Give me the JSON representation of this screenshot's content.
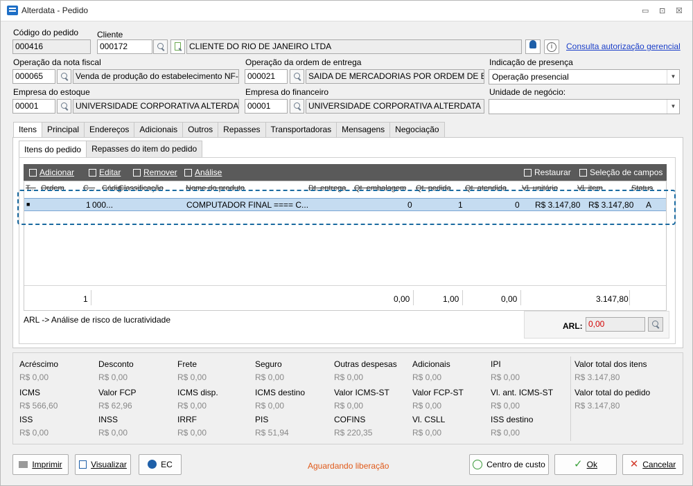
{
  "window": {
    "title": "Alterdata - Pedido",
    "min": "▭",
    "max": "⊡",
    "close": "☒"
  },
  "header": {
    "codigo_label": "Código do pedido",
    "codigo_value": "000416",
    "cliente_label": "Cliente",
    "cliente_code": "000172",
    "cliente_name": "CLIENTE DO RIO DE JANEIRO LTDA",
    "consulta_link": "Consulta autorização gerencial",
    "op_nf_label": "Operação da nota fiscal",
    "op_nf_code": "000065",
    "op_nf_name": "Venda de produção do estabelecimento NF-e",
    "op_oe_label": "Operação da ordem de entrega",
    "op_oe_code": "000021",
    "op_oe_name": "SAIDA DE MERCADORIAS POR ORDEM DE ENTRE",
    "presenca_label": "Indicação de presença",
    "presenca_value": "Operação presencial",
    "emp_est_label": "Empresa do estoque",
    "emp_est_code": "00001",
    "emp_est_name": "UNIVERSIDADE CORPORATIVA ALTERDATA",
    "emp_fin_label": "Empresa do financeiro",
    "emp_fin_code": "00001",
    "emp_fin_name": "UNIVERSIDADE CORPORATIVA ALTERDATA",
    "unidade_label": "Unidade de negócio:",
    "unidade_value": ""
  },
  "tabs": [
    "Itens",
    "Principal",
    "Endereços",
    "Adicionais",
    "Outros",
    "Repasses",
    "Transportadoras",
    "Mensagens",
    "Negociação"
  ],
  "subtabs": [
    "Itens do pedido",
    "Repasses do item do pedido"
  ],
  "toolbar": {
    "adicionar": "Adicionar",
    "editar": "Editar",
    "remover": "Remover",
    "analise": "Análise",
    "restaurar": "Restaurar",
    "selecao": "Seleção de campos"
  },
  "grid": {
    "columns": [
      "T...",
      "Ordem",
      "C...",
      "Códig",
      "Classificação",
      "Nome do produto",
      "Dt. entrega",
      "Qt. embalagem",
      "Qt. pedida",
      "Qt. atendida",
      "Vl. unitário",
      "Vl. item",
      "Status"
    ],
    "row": {
      "t": "■",
      "ordem": "1",
      "codigo": "000...",
      "nome": "COMPUTADOR FINAL ==== C...",
      "qt_emb": "0",
      "qt_ped": "1",
      "qt_at": "0",
      "vl_unit": "R$ 3.147,80",
      "vl_item": "R$ 3.147,80",
      "status": "A"
    },
    "footer": {
      "count": "1",
      "qt_emb": "0,00",
      "qt_ped": "1,00",
      "qt_at": "0,00",
      "vl_item": "3.147,80"
    }
  },
  "arl": {
    "caption": "ARL -> Análise de risco de lucratividade",
    "label": "ARL:",
    "value": "0,00"
  },
  "totals": [
    {
      "label": "Acréscimo",
      "value": "R$ 0,00"
    },
    {
      "label": "Desconto",
      "value": "R$ 0,00"
    },
    {
      "label": "Frete",
      "value": "R$ 0,00"
    },
    {
      "label": "Seguro",
      "value": "R$ 0,00"
    },
    {
      "label": "Outras despesas",
      "value": "R$ 0,00"
    },
    {
      "label": "Adicionais",
      "value": "R$ 0,00"
    },
    {
      "label": "IPI",
      "value": "R$ 0,00"
    },
    {
      "label": "ICMS",
      "value": "R$ 566,60"
    },
    {
      "label": "Valor FCP",
      "value": "R$ 62,96"
    },
    {
      "label": "ICMS disp.",
      "value": "R$ 0,00"
    },
    {
      "label": "ICMS destino",
      "value": "R$ 0,00"
    },
    {
      "label": "Valor ICMS-ST",
      "value": "R$ 0,00"
    },
    {
      "label": "Valor FCP-ST",
      "value": "R$ 0,00"
    },
    {
      "label": "Vl. ant. ICMS-ST",
      "value": "R$ 0,00"
    },
    {
      "label": "ISS",
      "value": "R$ 0,00"
    },
    {
      "label": "INSS",
      "value": "R$ 0,00"
    },
    {
      "label": "IRRF",
      "value": "R$ 0,00"
    },
    {
      "label": "PIS",
      "value": "R$ 51,94"
    },
    {
      "label": "COFINS",
      "value": "R$ 220,35"
    },
    {
      "label": "Vl. CSLL",
      "value": "R$ 0,00"
    },
    {
      "label": "ISS destino",
      "value": "R$ 0,00"
    }
  ],
  "summary": {
    "itens_label": "Valor total dos itens",
    "itens_value": "R$ 3.147,80",
    "pedido_label": "Valor total do pedido",
    "pedido_value": "R$ 3.147,80"
  },
  "footer": {
    "imprimir": "Imprimir",
    "visualizar": "Visualizar",
    "ec": "EC",
    "status": "Aguardando liberação",
    "centro": "Centro de custo",
    "ok": "Ok",
    "cancelar": "Cancelar"
  },
  "colors": {
    "accent": "#1a6aa0",
    "status": "#e05a1a",
    "toolbar": "#5a5a5a",
    "row": "#c5dcf1",
    "arl": "#d40000"
  }
}
